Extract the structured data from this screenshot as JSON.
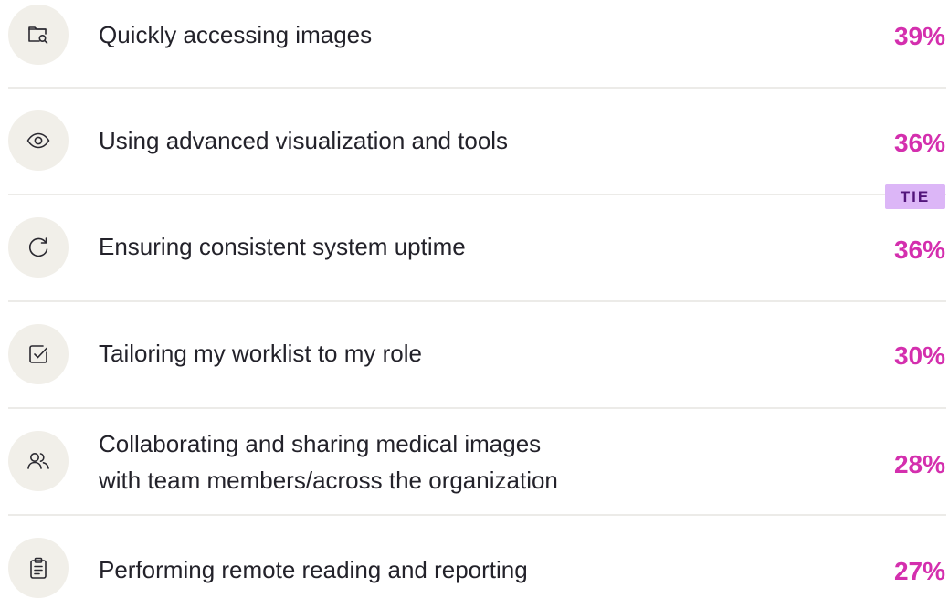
{
  "chart_data": {
    "type": "table",
    "rows": [
      {
        "icon": "folder-search-icon",
        "label": "Quickly accessing images",
        "value": 39,
        "value_label": "39%"
      },
      {
        "icon": "eye-icon",
        "label": "Using advanced visualization and tools",
        "value": 36,
        "value_label": "36%"
      },
      {
        "icon": "refresh-icon",
        "label": "Ensuring consistent system uptime",
        "value": 36,
        "value_label": "36%"
      },
      {
        "icon": "checkbox-icon",
        "label": "Tailoring my worklist to my role",
        "value": 30,
        "value_label": "30%"
      },
      {
        "icon": "users-icon",
        "label_lines": [
          "Collaborating and sharing medical images",
          "with team members/across the organization"
        ],
        "value": 28,
        "value_label": "28%"
      },
      {
        "icon": "clipboard-icon",
        "label": "Performing remote reading and reporting",
        "value": 27,
        "value_label": "27%"
      }
    ],
    "tie_badge": "TIE"
  },
  "colors": {
    "percent": "#d42fae",
    "icon_background": "#f1efe9",
    "divider": "#ecebe8",
    "tie_background": "#dcb6f7",
    "tie_text": "#53157b"
  }
}
